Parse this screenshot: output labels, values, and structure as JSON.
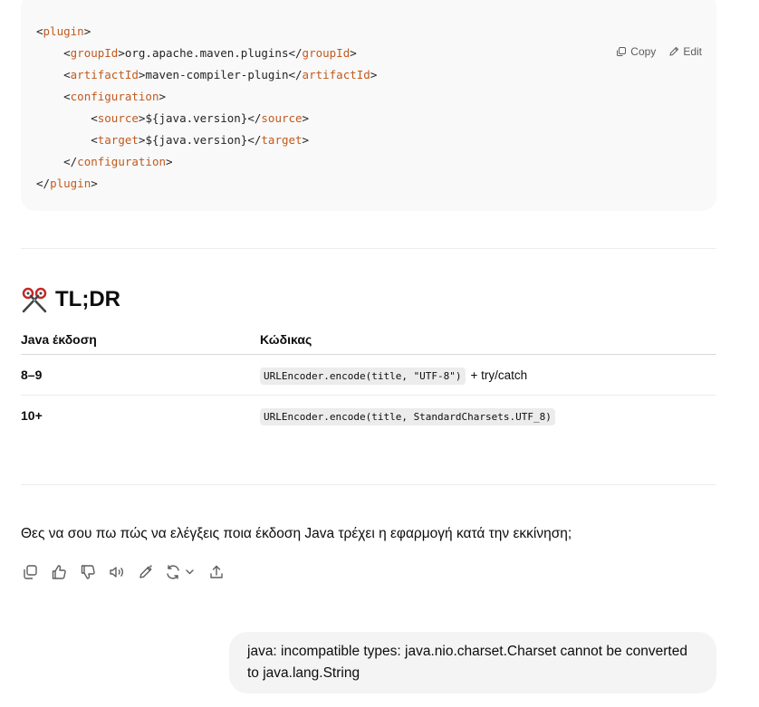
{
  "code": {
    "lines": [
      {
        "indent": "",
        "open": "plugin",
        "text": "",
        "close": ""
      },
      {
        "indent": "    ",
        "open": "groupId",
        "text": "org.apache.maven.plugins",
        "close": "groupId"
      },
      {
        "indent": "    ",
        "open": "artifactId",
        "text": "maven-compiler-plugin",
        "close": "artifactId"
      },
      {
        "indent": "    ",
        "open": "configuration",
        "text": "",
        "close": ""
      },
      {
        "indent": "        ",
        "open": "source",
        "text": "${java.version}",
        "close": "source"
      },
      {
        "indent": "        ",
        "open": "target",
        "text": "${java.version}",
        "close": "target"
      },
      {
        "indent": "    ",
        "open": "",
        "text": "",
        "close": "configuration"
      },
      {
        "indent": "",
        "open": "",
        "text": "",
        "close": "plugin"
      }
    ],
    "copy_label": "Copy",
    "edit_label": "Edit"
  },
  "tldr": {
    "emoji_icon": "scissors-icon",
    "title": "TL;DR"
  },
  "table": {
    "headers": [
      "Java έκδοση",
      "Κώδικας"
    ],
    "rows": [
      {
        "version": "8–9",
        "code": "URLEncoder.encode(title, \"UTF-8\")",
        "suffix": "+ try/catch"
      },
      {
        "version": "10+",
        "code": "URLEncoder.encode(title, StandardCharsets.UTF_8)",
        "suffix": ""
      }
    ]
  },
  "question": "Θες να σου πω πώς να ελέγξεις ποια έκδοση Java τρέχει η εφαρμογή κατά την εκκίνηση;",
  "message_actions": [
    "copy-icon",
    "thumbs-up-icon",
    "thumbs-down-icon",
    "read-aloud-icon",
    "edit-icon",
    "regenerate-icon",
    "share-icon"
  ],
  "user_message": "java: incompatible types: java.nio.charset.Charset cannot be converted to java.lang.String",
  "colors": {
    "tag": "#c15a1e",
    "code_bg": "#f9f9f9",
    "bubble_bg": "#f4f4f4"
  }
}
